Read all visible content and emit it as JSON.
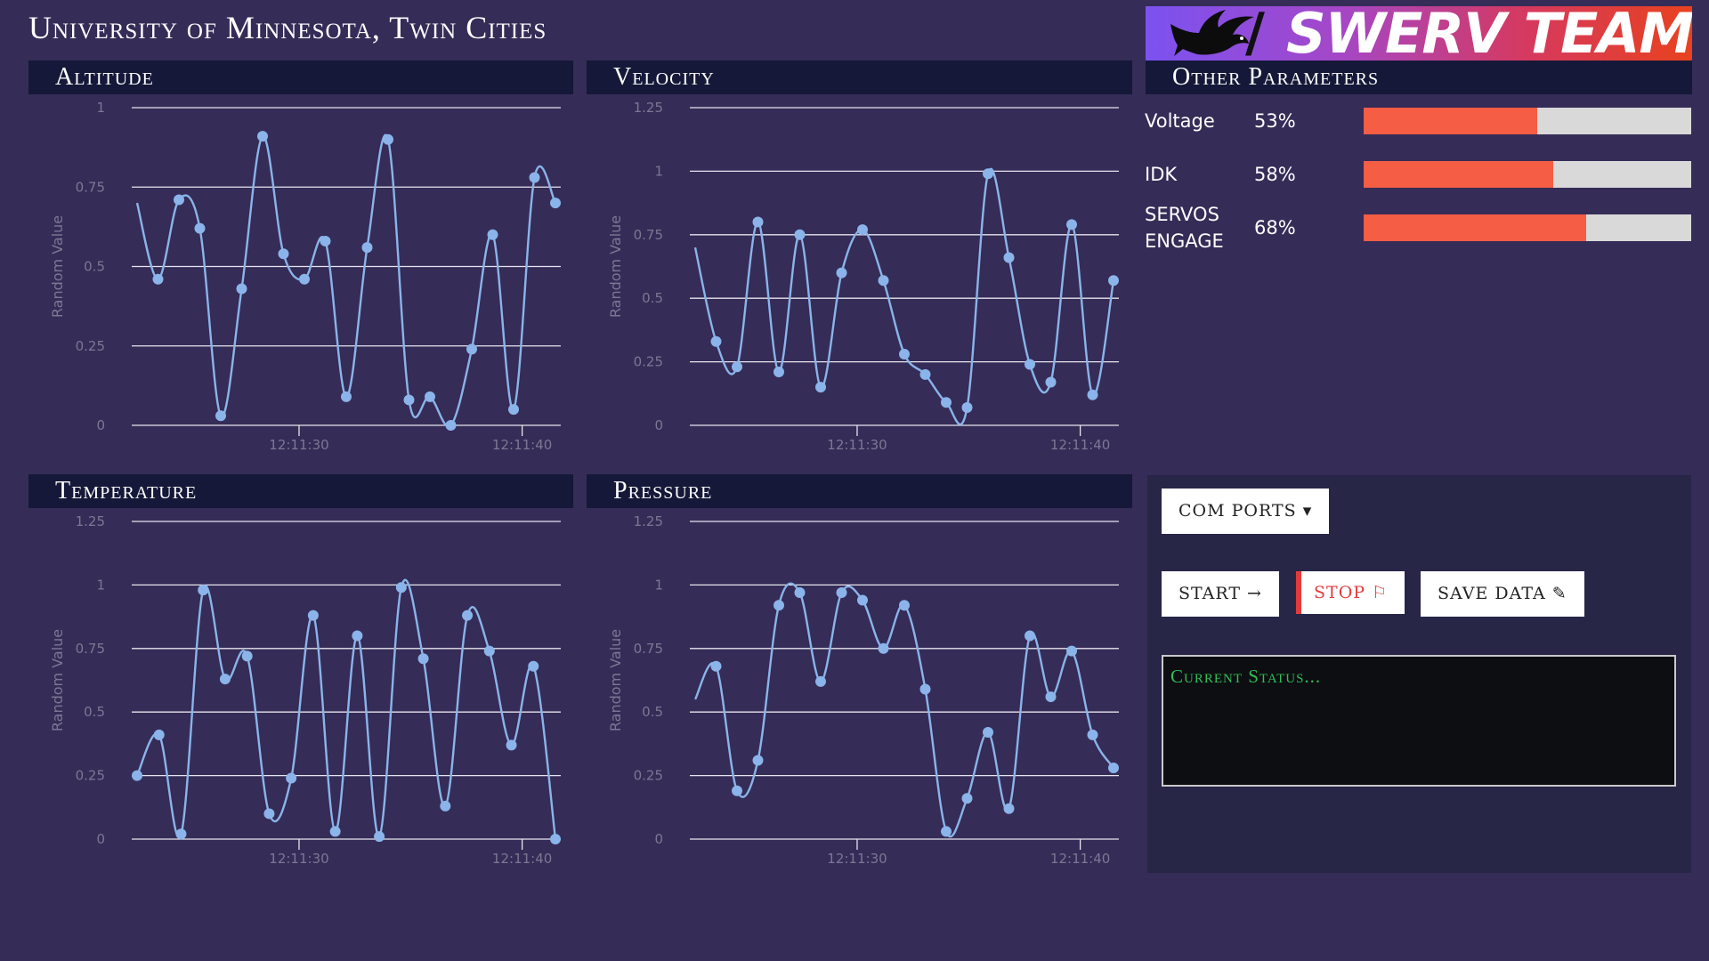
{
  "header": {
    "title": "University of Minnesota, Twin Cities"
  },
  "logo": {
    "slash": "/",
    "team_name": "SWERV TEAM"
  },
  "colors": {
    "background": "#352c57",
    "panel_header": "#151838",
    "line": "#8ab4ea",
    "bar_fill": "#f55d44",
    "bar_track": "#d9d9d9",
    "status_text": "#2fbf55"
  },
  "charts": {
    "altitude_title": "Altitude",
    "velocity_title": "Velocity",
    "temperature_title": "Temperature",
    "pressure_title": "Pressure"
  },
  "chart_data": [
    {
      "type": "line",
      "title": "Altitude",
      "ylabel": "Random Value",
      "ylim": [
        0,
        1
      ],
      "yticks": [
        "0",
        "0.25",
        "0.5",
        "0.75",
        "1"
      ],
      "xticks": [
        "12:11:30",
        "12:11:40"
      ],
      "grid": true,
      "series": [
        {
          "values": [
            0.7,
            0.46,
            0.71,
            0.62,
            0.03,
            0.43,
            0.91,
            0.54,
            0.46,
            0.58,
            0.09,
            0.56,
            0.9,
            0.08,
            0.09,
            0.0,
            0.24,
            0.6,
            0.05,
            0.78,
            0.7
          ],
          "markers": [
            false,
            true,
            true,
            true,
            true,
            true,
            true,
            true,
            true,
            true,
            true,
            true,
            true,
            true,
            true,
            true,
            true,
            true,
            true,
            true,
            true
          ]
        }
      ]
    },
    {
      "type": "line",
      "title": "Velocity",
      "ylabel": "Random Value",
      "ylim": [
        0,
        1.25
      ],
      "yticks": [
        "0",
        "0.25",
        "0.5",
        "0.75",
        "1",
        "1.25"
      ],
      "xticks": [
        "12:11:30",
        "12:11:40"
      ],
      "grid": true,
      "series": [
        {
          "values": [
            0.7,
            0.33,
            0.23,
            0.8,
            0.21,
            0.75,
            0.15,
            0.6,
            0.77,
            0.57,
            0.28,
            0.2,
            0.09,
            0.07,
            0.99,
            0.66,
            0.24,
            0.17,
            0.79,
            0.12,
            0.57
          ],
          "markers": [
            false,
            true,
            true,
            true,
            true,
            true,
            true,
            true,
            true,
            true,
            true,
            true,
            true,
            true,
            true,
            true,
            true,
            true,
            true,
            true,
            true
          ]
        }
      ]
    },
    {
      "type": "line",
      "title": "Temperature",
      "ylabel": "Random Value",
      "ylim": [
        0,
        1.25
      ],
      "yticks": [
        "0",
        "0.25",
        "0.5",
        "0.75",
        "1",
        "1.25"
      ],
      "xticks": [
        "12:11:30",
        "12:11:40"
      ],
      "grid": true,
      "series": [
        {
          "values": [
            0.25,
            0.41,
            0.02,
            0.98,
            0.63,
            0.72,
            0.1,
            0.24,
            0.88,
            0.03,
            0.8,
            0.01,
            0.99,
            0.71,
            0.13,
            0.88,
            0.74,
            0.37,
            0.68,
            0.0
          ],
          "markers": [
            true,
            true,
            true,
            true,
            true,
            true,
            true,
            true,
            true,
            true,
            true,
            true,
            true,
            true,
            true,
            true,
            true,
            true,
            true,
            true
          ]
        }
      ]
    },
    {
      "type": "line",
      "title": "Pressure",
      "ylabel": "Random Value",
      "ylim": [
        0,
        1.25
      ],
      "yticks": [
        "0",
        "0.25",
        "0.5",
        "0.75",
        "1",
        "1.25"
      ],
      "xticks": [
        "12:11:30",
        "12:11:40"
      ],
      "grid": true,
      "series": [
        {
          "values": [
            0.55,
            0.68,
            0.19,
            0.31,
            0.92,
            0.97,
            0.62,
            0.97,
            0.94,
            0.75,
            0.92,
            0.59,
            0.03,
            0.16,
            0.42,
            0.12,
            0.8,
            0.56,
            0.74,
            0.41,
            0.28
          ],
          "markers": [
            false,
            true,
            true,
            true,
            true,
            true,
            true,
            true,
            true,
            true,
            true,
            true,
            true,
            true,
            true,
            true,
            true,
            true,
            true,
            true,
            true
          ]
        }
      ]
    }
  ],
  "other_parameters": {
    "title": "Other Parameters",
    "items": [
      {
        "label_line1": "Voltage",
        "label_line2": "",
        "value": "53%",
        "fraction": 0.53
      },
      {
        "label_line1": "IDK",
        "label_line2": "",
        "value": "58%",
        "fraction": 0.58
      },
      {
        "label_line1": "SERVOS",
        "label_line2": "ENGAGE",
        "value": "68%",
        "fraction": 0.68
      }
    ]
  },
  "controls": {
    "com_ports_label": "COM PORTS",
    "com_ports_icon": "▾",
    "start_label": "START →",
    "stop_label": "STOP",
    "stop_icon": "⚐",
    "save_label": "SAVE DATA",
    "save_icon": "✎",
    "status_text": "Current Status..."
  }
}
